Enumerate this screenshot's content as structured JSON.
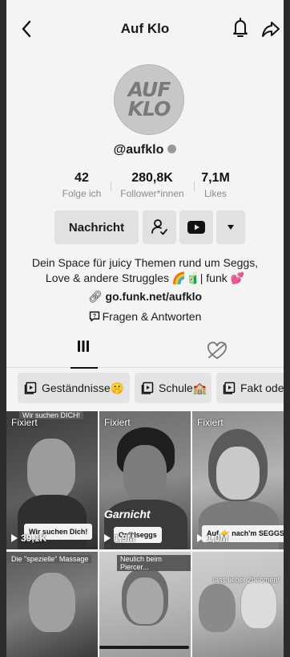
{
  "header": {
    "title": "Auf Klo",
    "back_icon": "chevron-left-icon",
    "bell_icon": "bell-icon",
    "share_icon": "share-icon"
  },
  "profile": {
    "avatar_text_line1": "AUF",
    "avatar_text_line2": "KLO",
    "handle": "@aufklo",
    "verified": true
  },
  "stats": [
    {
      "value": "42",
      "label": "Folge ich"
    },
    {
      "value": "280,8K",
      "label": "Follower*innen"
    },
    {
      "value": "7,1M",
      "label": "Likes"
    }
  ],
  "actions": {
    "message_label": "Nachricht",
    "follow_icon": "person-check-icon",
    "youtube_icon": "youtube-icon",
    "more_icon": "caret-down-icon"
  },
  "bio": {
    "line1": "Dein Space für juicy Themen rund um Seggs,",
    "line2": "Love & andere Struggles 🌈🧃| funk 💕",
    "link": "go.funk.net/aufklo",
    "qa_label": "Fragen & Antworten"
  },
  "tabs": {
    "videos_icon": "grid-icon",
    "liked_icon": "heart-hidden-icon"
  },
  "playlists": [
    {
      "label": "Geständnisse🤫"
    },
    {
      "label": "Schule🏫"
    },
    {
      "label": "Fakt oder F"
    }
  ],
  "videos": [
    {
      "pinned": "Fixiert",
      "views": "39,1K",
      "top_caption": "Wir suchen DICH!",
      "sticker": "Wir suchen Dich!"
    },
    {
      "pinned": "Fixiert",
      "views": "1,9M",
      "overlay": "Garnicht",
      "sticker": "Or@lseggs"
    },
    {
      "pinned": "Fixiert",
      "views": "1,0M",
      "sticker": "Auf 👉 nach'm SEGGS"
    },
    {
      "top_caption": "Die \"spezielle\" Massage"
    },
    {
      "top_caption": "Neulich beim Piercer..."
    },
    {
      "top_caption": "lass lieber 2nehmen!"
    }
  ]
}
